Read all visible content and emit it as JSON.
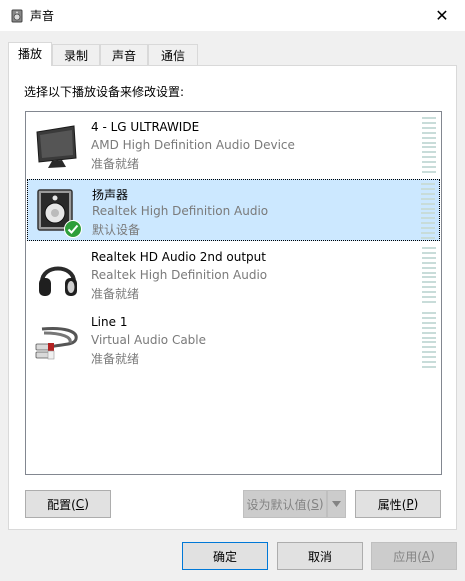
{
  "window": {
    "title": "声音",
    "close_glyph": "✕"
  },
  "tabs": [
    {
      "label": "播放",
      "active": true
    },
    {
      "label": "录制",
      "active": false
    },
    {
      "label": "声音",
      "active": false
    },
    {
      "label": "通信",
      "active": false
    }
  ],
  "instruction": "选择以下播放设备来修改设置:",
  "devices": [
    {
      "name": "4 - LG ULTRAWIDE",
      "driver": "AMD High Definition Audio Device",
      "status": "准备就绪",
      "icon": "monitor-icon",
      "selected": false
    },
    {
      "name": "扬声器",
      "driver": "Realtek High Definition Audio",
      "status": "默认设备",
      "icon": "speaker-icon",
      "selected": true
    },
    {
      "name": "Realtek HD Audio 2nd output",
      "driver": "Realtek High Definition Audio",
      "status": "准备就绪",
      "icon": "headphones-icon",
      "selected": false
    },
    {
      "name": "Line 1",
      "driver": "Virtual Audio Cable",
      "status": "准备就绪",
      "icon": "rca-cable-icon",
      "selected": false
    }
  ],
  "buttons": {
    "configure": {
      "label": "配置(",
      "key": "C",
      "suffix": ")"
    },
    "set_default": {
      "label": "设为默认值(",
      "key": "S",
      "suffix": ")"
    },
    "properties": {
      "label": "属性(",
      "key": "P",
      "suffix": ")"
    },
    "ok": {
      "label": "确定"
    },
    "cancel": {
      "label": "取消"
    },
    "apply": {
      "label": "应用(",
      "key": "A",
      "suffix": ")"
    }
  },
  "colors": {
    "selection": "#cce8ff",
    "meter": "#c8dcd9",
    "check_badge": "#2e9e3a"
  }
}
